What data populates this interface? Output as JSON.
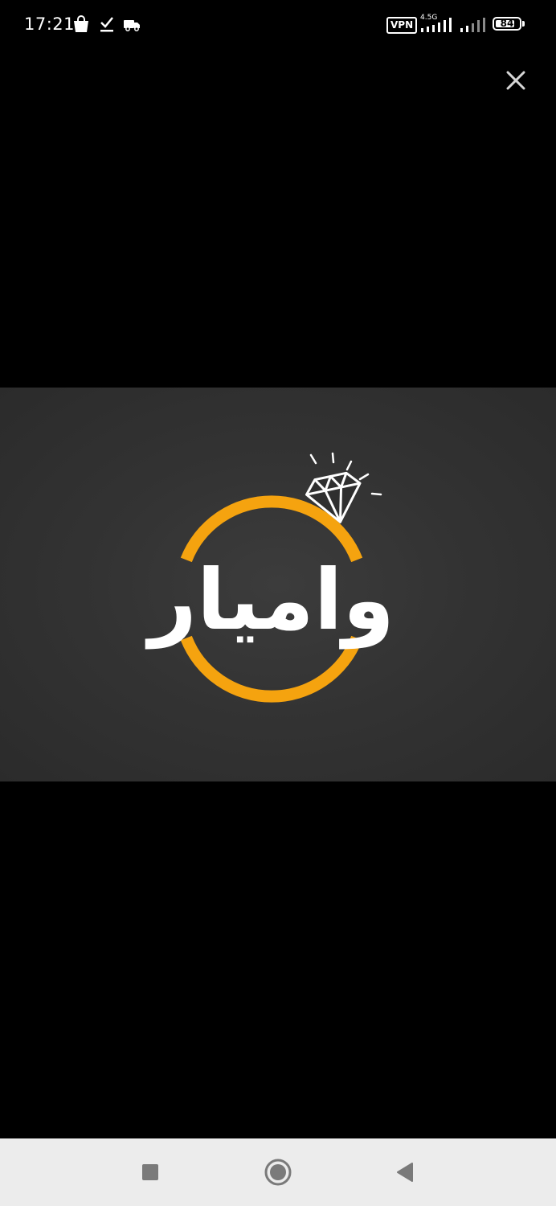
{
  "status_bar": {
    "time": "17:21",
    "vpn_label": "VPN",
    "network_type": "4.5G",
    "battery_level": "84",
    "battery_percent": 84,
    "icons": [
      "shopping-bag-icon",
      "download-done-icon",
      "truck-icon",
      "signal-icon",
      "signal-icon"
    ]
  },
  "viewer": {
    "close_icon": "close-icon"
  },
  "image": {
    "logo_text": "وامیار",
    "logo_ring_color": "#F5A30F",
    "logo_text_color": "#FFFFFF",
    "background_color": "#333333"
  },
  "nav_bar": {
    "buttons": [
      "recents-icon",
      "home-icon",
      "back-icon"
    ]
  }
}
